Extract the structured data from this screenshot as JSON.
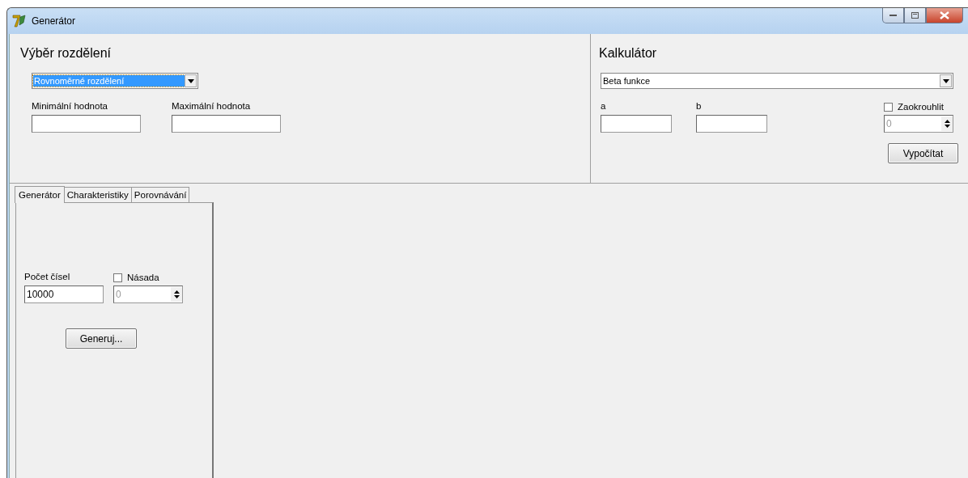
{
  "window": {
    "title": "Generátor"
  },
  "distribution": {
    "heading": "Výběr rozdělení",
    "select": {
      "value": "Rovnoměrné rozdělení",
      "highlighted": true
    },
    "fields": [
      {
        "label": "Minimální hodnota"
      },
      {
        "label": "Maximální hodnota"
      }
    ]
  },
  "calculator": {
    "heading": "Kalkulátor",
    "select": {
      "value": "Beta funkce",
      "highlighted": false
    },
    "fields": [
      {
        "label": "a"
      },
      {
        "label": "b"
      }
    ],
    "round": {
      "label": "Zaokrouhlit",
      "checked": false
    },
    "spinner": {
      "value": "0",
      "disabled": true
    },
    "button": "Vypočítat"
  },
  "tabs": [
    {
      "label": "Generátor",
      "selected": true
    },
    {
      "label": "Charakteristiky",
      "selected": false
    },
    {
      "label": "Porovnávání",
      "selected": false
    }
  ],
  "generator": {
    "count_label": "Počet čísel",
    "count_value": "10000",
    "seed": {
      "label": "Násada",
      "checked": false
    },
    "seed_spinner": {
      "value": "0",
      "disabled": true
    },
    "button": "Generuj..."
  }
}
